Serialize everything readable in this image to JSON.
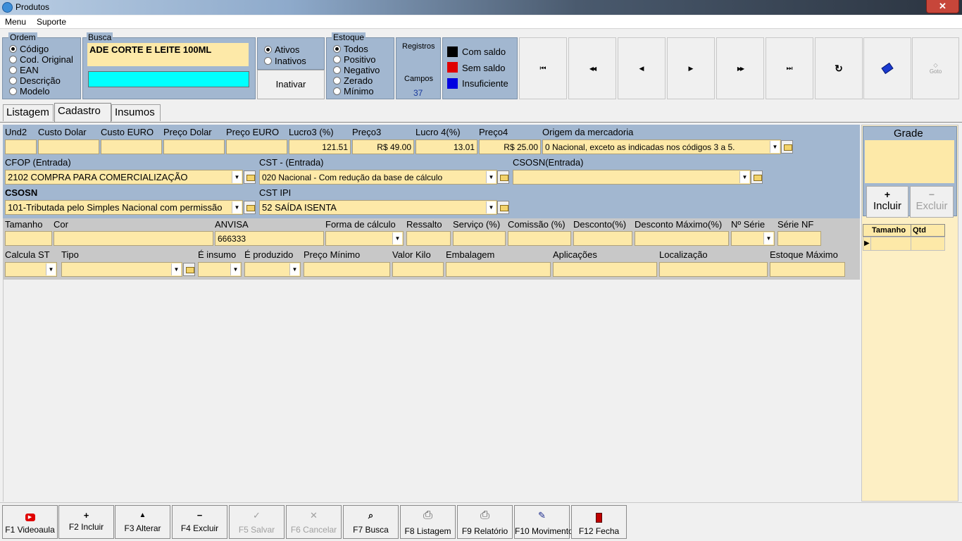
{
  "window": {
    "title": "Produtos",
    "close": "✕"
  },
  "menu": [
    "Menu",
    "Suporte"
  ],
  "ordem": {
    "legend": "Ordem",
    "options": [
      "Código",
      "Cod. Original",
      "EAN",
      "Descrição",
      "Modelo"
    ],
    "selected": 0
  },
  "busca": {
    "legend": "Busca",
    "value": "ADE CORTE E LEITE 100ML",
    "second_value": ""
  },
  "status": {
    "options": [
      "Ativos",
      "Inativos"
    ],
    "selected": 0,
    "button": "Inativar"
  },
  "estoque": {
    "legend": "Estoque",
    "options": [
      "Todos",
      "Positivo",
      "Negativo",
      "Zerado",
      "Mínimo"
    ],
    "selected": 0
  },
  "registros": {
    "label": "Registros",
    "campos_label": "Campos",
    "campos_value": "37"
  },
  "saldo_legend": [
    {
      "label": "Com saldo",
      "color": "#000000"
    },
    {
      "label": "Sem saldo",
      "color": "#e00000"
    },
    {
      "label": "Insuficiente",
      "color": "#0000e0"
    }
  ],
  "nav": {
    "first": "⏮",
    "prev_page": "◀◀",
    "prev": "◀",
    "next": "▶",
    "next_page": "▶▶",
    "last": "⏭",
    "refresh": "↻",
    "goto_label": "Goto"
  },
  "tabs": [
    "Listagem",
    "Cadastro",
    "Insumos"
  ],
  "row1": {
    "labels": [
      "Und2",
      "Custo Dolar",
      "Custo EURO",
      "Preço Dolar",
      "Preço EURO",
      "Lucro3 (%)",
      "Preço3",
      "Lucro 4(%)",
      "Preço4",
      "Origem da mercadoria"
    ],
    "values": [
      "",
      "",
      "",
      "",
      "",
      "121.51",
      "R$ 49.00",
      "13.01",
      "R$ 25.00",
      "0 Nacional, exceto as indicadas nos códigos 3 a 5."
    ]
  },
  "row2": {
    "labels": [
      "CFOP (Entrada)",
      "CST - (Entrada)",
      "CSOSN(Entrada)"
    ],
    "values": [
      "2102 COMPRA PARA COMERCIALIZAÇÃO",
      "020 Nacional - Com redução da base de cálculo",
      ""
    ]
  },
  "row3": {
    "labels": [
      "CSOSN",
      "CST IPI"
    ],
    "values": [
      "101-Tributada pelo Simples Nacional com permissão",
      "52 SAÍDA ISENTA"
    ]
  },
  "row4": {
    "labels": [
      "Tamanho",
      "Cor",
      "ANVISA",
      "Forma de cálculo",
      "Ressalto",
      "Serviço (%)",
      "Comissão (%)",
      "Desconto(%)",
      "Desconto Máximo(%)",
      "Nº Série",
      "Série NF"
    ],
    "values": [
      "",
      "",
      "666333",
      "",
      "",
      "",
      "",
      "",
      "",
      "",
      ""
    ]
  },
  "row5": {
    "labels": [
      "Calcula ST",
      "Tipo",
      "É insumo",
      "É produzido",
      "Preço Mínimo",
      "Valor Kilo",
      "Embalagem",
      "Aplicações",
      "Localização",
      "Estoque Máximo"
    ],
    "values": [
      "",
      "",
      "",
      "",
      "",
      "",
      "",
      "",
      "",
      ""
    ]
  },
  "grade": {
    "title": "Grade",
    "incluir": "Incluir",
    "excluir": "Excluir",
    "columns": [
      "Tamanho",
      "Qtd"
    ]
  },
  "fkeys": [
    {
      "icon": "▶",
      "label": "F1 Videoaula",
      "enabled": true
    },
    {
      "icon": "+",
      "label": "F2 Incluir",
      "enabled": true
    },
    {
      "icon": "▲",
      "label": "F3 Alterar",
      "enabled": true
    },
    {
      "icon": "−",
      "label": "F4 Excluir",
      "enabled": true
    },
    {
      "icon": "✓",
      "label": "F5 Salvar",
      "enabled": false
    },
    {
      "icon": "✕",
      "label": "F6 Cancelar",
      "enabled": false
    },
    {
      "icon": "⌕",
      "label": "F7 Busca",
      "enabled": true
    },
    {
      "icon": "⎙",
      "label": "F8 Listagem",
      "enabled": true
    },
    {
      "icon": "⎙",
      "label": "F9 Relatório",
      "enabled": true
    },
    {
      "icon": "✎",
      "label": "F10 Movimento",
      "enabled": true
    },
    {
      "icon": "▮",
      "label": "F12 Fecha",
      "enabled": true
    }
  ]
}
